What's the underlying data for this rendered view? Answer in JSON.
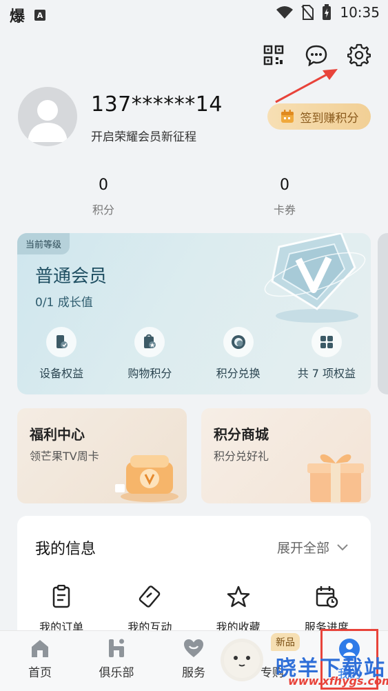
{
  "status_bar": {
    "left_glyph": "爆",
    "left_badge": "A",
    "time": "10:35"
  },
  "profile": {
    "username": "137******14",
    "subtitle": "开启荣耀会员新征程",
    "signin_label": "签到赚积分"
  },
  "stats": [
    {
      "value": "0",
      "label": "积分"
    },
    {
      "value": "0",
      "label": "卡券"
    }
  ],
  "member_card": {
    "tag": "当前等级",
    "level": "普通会员",
    "growth": "0/1 成长值",
    "benefits": [
      {
        "label": "设备权益",
        "icon": "device-benefit-icon"
      },
      {
        "label": "购物积分",
        "icon": "shopping-points-icon"
      },
      {
        "label": "积分兑换",
        "icon": "points-exchange-icon"
      },
      {
        "label": "共 7 项权益",
        "icon": "all-benefits-grid-icon"
      }
    ]
  },
  "promos": [
    {
      "title": "福利中心",
      "subtitle": "领芒果TV周卡"
    },
    {
      "title": "积分商城",
      "subtitle": "积分兑好礼"
    }
  ],
  "my_info": {
    "title": "我的信息",
    "expand_label": "展开全部",
    "items": [
      {
        "label": "我的订单",
        "icon": "order-icon"
      },
      {
        "label": "我的互动",
        "icon": "interaction-icon"
      },
      {
        "label": "我的收藏",
        "icon": "star-icon"
      },
      {
        "label": "服务进度",
        "icon": "service-progress-icon"
      }
    ]
  },
  "bottom_nav": {
    "items": [
      {
        "label": "首页",
        "icon": "home-icon"
      },
      {
        "label": "俱乐部",
        "icon": "club-icon"
      },
      {
        "label": "服务",
        "icon": "heart-icon"
      },
      {
        "label": "专购",
        "icon": "mascot-icon"
      },
      {
        "label": "我的",
        "icon": "profile-icon"
      }
    ],
    "new_badge": "新品",
    "active": "我的"
  },
  "watermark": {
    "text": "晓羊下载站",
    "url": "www.xfhygs.com"
  },
  "colors": {
    "accent_blue": "#2f7be8",
    "signin_gold": "#f1cf95",
    "highlight_red": "#e8433a"
  }
}
